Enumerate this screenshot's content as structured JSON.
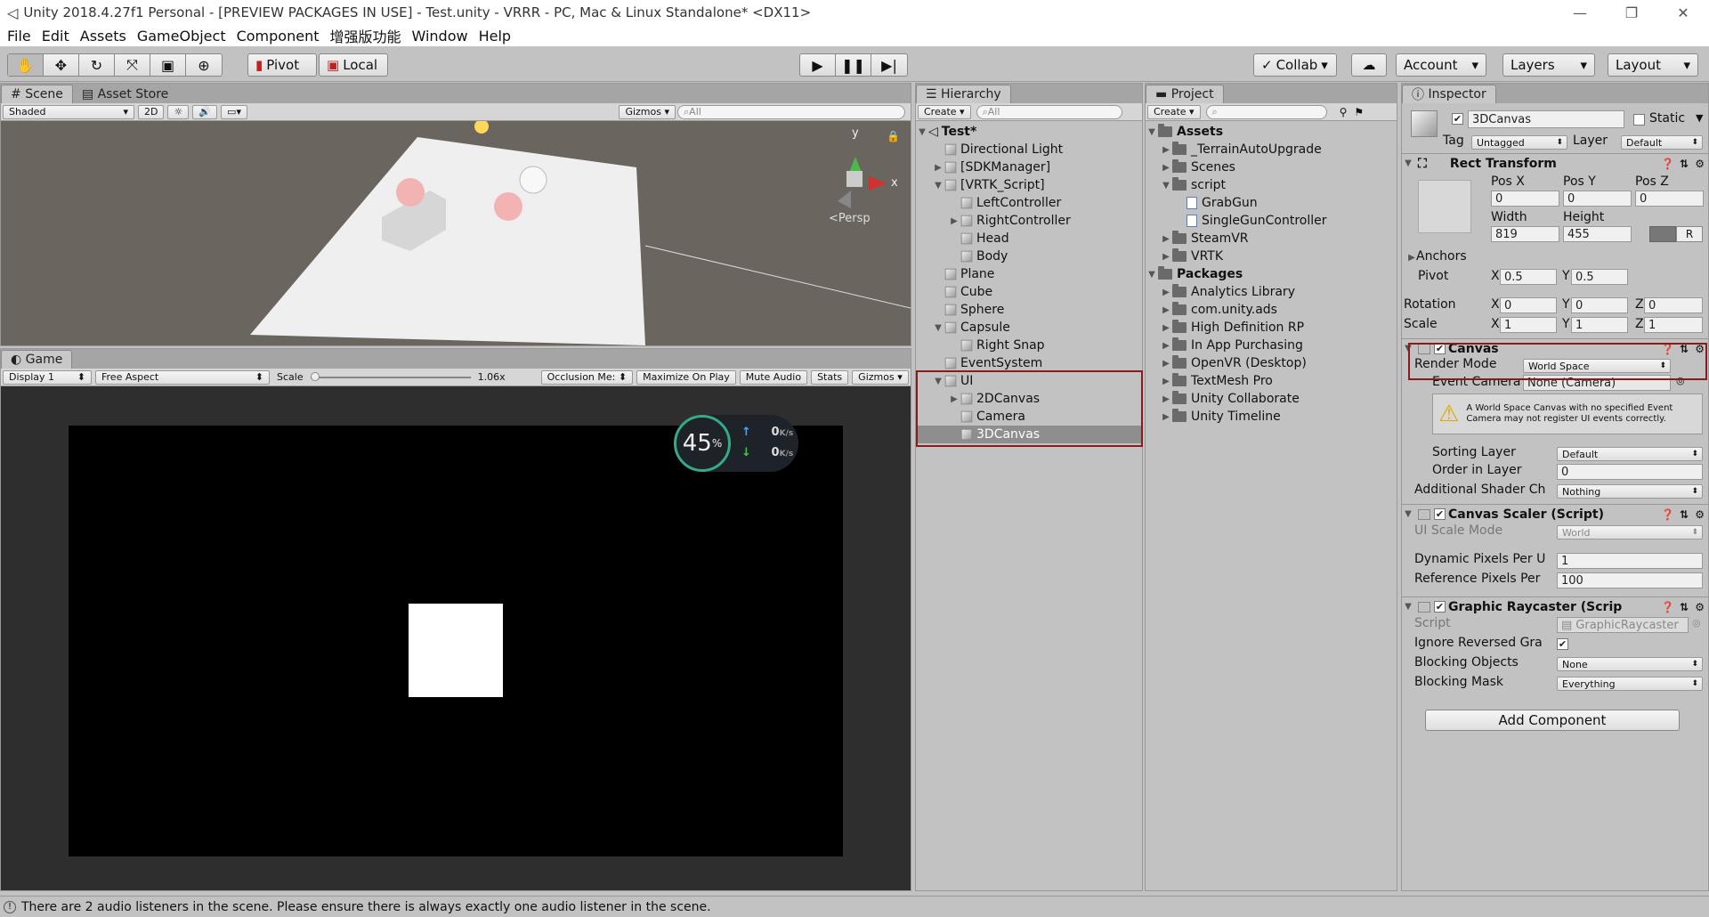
{
  "window": {
    "title": "Unity 2018.4.27f1 Personal - [PREVIEW PACKAGES IN USE] - Test.unity - VRRR - PC, Mac & Linux Standalone* <DX11>"
  },
  "menu": [
    "File",
    "Edit",
    "Assets",
    "GameObject",
    "Component",
    "增强版功能",
    "Window",
    "Help"
  ],
  "toolbar": {
    "pivot": "Pivot",
    "local": "Local",
    "collab": "Collab",
    "account": "Account",
    "layers": "Layers",
    "layout": "Layout"
  },
  "scene": {
    "tab": "Scene",
    "asset_store": "Asset Store",
    "shaded": "Shaded",
    "mode_2d": "2D",
    "gizmos": "Gizmos",
    "search_placeholder": "All",
    "persp": "Persp",
    "axis_y": "y",
    "axis_x": "x"
  },
  "game": {
    "tab": "Game",
    "display": "Display 1",
    "aspect": "Free Aspect",
    "scale_label": "Scale",
    "scale_value": "1.06x",
    "occlusion": "Occlusion Me:",
    "maximize": "Maximize On Play",
    "mute": "Mute Audio",
    "stats": "Stats",
    "gizmos": "Gizmos",
    "overlay_percent": "45",
    "overlay_percent_unit": "%",
    "overlay_up": "0",
    "overlay_down": "0",
    "overlay_unit": "K/s"
  },
  "hierarchy": {
    "tab": "Hierarchy",
    "create": "Create",
    "search_placeholder": "All",
    "scene_name": "Test*",
    "items": [
      {
        "label": "Directional Light",
        "indent": 1,
        "arrow": ""
      },
      {
        "label": "[SDKManager]",
        "indent": 1,
        "arrow": "▶"
      },
      {
        "label": "[VRTK_Script]",
        "indent": 1,
        "arrow": "▼"
      },
      {
        "label": "LeftController",
        "indent": 2,
        "arrow": ""
      },
      {
        "label": "RightController",
        "indent": 2,
        "arrow": "▶"
      },
      {
        "label": "Head",
        "indent": 2,
        "arrow": ""
      },
      {
        "label": "Body",
        "indent": 2,
        "arrow": ""
      },
      {
        "label": "Plane",
        "indent": 1,
        "arrow": ""
      },
      {
        "label": "Cube",
        "indent": 1,
        "arrow": ""
      },
      {
        "label": "Sphere",
        "indent": 1,
        "arrow": ""
      },
      {
        "label": "Capsule",
        "indent": 1,
        "arrow": "▼"
      },
      {
        "label": "Right Snap",
        "indent": 2,
        "arrow": ""
      },
      {
        "label": "EventSystem",
        "indent": 1,
        "arrow": ""
      },
      {
        "label": "UI",
        "indent": 1,
        "arrow": "▼"
      },
      {
        "label": "2DCanvas",
        "indent": 2,
        "arrow": "▶"
      },
      {
        "label": "Camera",
        "indent": 2,
        "arrow": ""
      },
      {
        "label": "3DCanvas",
        "indent": 2,
        "arrow": "",
        "selected": true
      }
    ]
  },
  "project": {
    "tab": "Project",
    "create": "Create",
    "items": [
      {
        "label": "Assets",
        "indent": 0,
        "arrow": "▼",
        "type": "folder",
        "bold": true
      },
      {
        "label": "_TerrainAutoUpgrade",
        "indent": 1,
        "arrow": "▶",
        "type": "folder"
      },
      {
        "label": "Scenes",
        "indent": 1,
        "arrow": "▶",
        "type": "folder"
      },
      {
        "label": "script",
        "indent": 1,
        "arrow": "▼",
        "type": "folder"
      },
      {
        "label": "GrabGun",
        "indent": 2,
        "arrow": "",
        "type": "script"
      },
      {
        "label": "SingleGunController",
        "indent": 2,
        "arrow": "",
        "type": "script"
      },
      {
        "label": "SteamVR",
        "indent": 1,
        "arrow": "▶",
        "type": "folder"
      },
      {
        "label": "VRTK",
        "indent": 1,
        "arrow": "▶",
        "type": "folder"
      },
      {
        "label": "Packages",
        "indent": 0,
        "arrow": "▼",
        "type": "folder",
        "bold": true
      },
      {
        "label": "Analytics Library",
        "indent": 1,
        "arrow": "▶",
        "type": "folder"
      },
      {
        "label": "com.unity.ads",
        "indent": 1,
        "arrow": "▶",
        "type": "folder"
      },
      {
        "label": "High Definition RP",
        "indent": 1,
        "arrow": "▶",
        "type": "folder"
      },
      {
        "label": "In App Purchasing",
        "indent": 1,
        "arrow": "▶",
        "type": "folder"
      },
      {
        "label": "OpenVR (Desktop)",
        "indent": 1,
        "arrow": "▶",
        "type": "folder"
      },
      {
        "label": "TextMesh Pro",
        "indent": 1,
        "arrow": "▶",
        "type": "folder"
      },
      {
        "label": "Unity Collaborate",
        "indent": 1,
        "arrow": "▶",
        "type": "folder"
      },
      {
        "label": "Unity Timeline",
        "indent": 1,
        "arrow": "▶",
        "type": "folder"
      }
    ]
  },
  "inspector": {
    "tab": "Inspector",
    "name": "3DCanvas",
    "static": "Static",
    "tag_label": "Tag",
    "tag": "Untagged",
    "layer_label": "Layer",
    "layer": "Default",
    "rect": {
      "title": "Rect Transform",
      "posx_label": "Pos X",
      "posy_label": "Pos Y",
      "posz_label": "Pos Z",
      "posx": "0",
      "posy": "0",
      "posz": "0",
      "width_label": "Width",
      "height_label": "Height",
      "width": "819",
      "height": "455",
      "r": "R",
      "anchors": "Anchors",
      "pivot_label": "Pivot",
      "pivot_x": "0.5",
      "pivot_y": "0.5",
      "rotation_label": "Rotation",
      "rot_x": "0",
      "rot_y": "0",
      "rot_z": "0",
      "scale_label": "Scale",
      "scale_x": "1",
      "scale_y": "1",
      "scale_z": "1",
      "x": "X",
      "y": "Y",
      "z": "Z"
    },
    "canvas": {
      "title": "Canvas",
      "render_mode_label": "Render Mode",
      "render_mode": "World Space",
      "event_camera_label": "Event Camera",
      "event_camera": "None (Camera)",
      "warning": "A World Space Canvas with no specified Event Camera may not register UI events correctly.",
      "sorting_layer_label": "Sorting Layer",
      "sorting_layer": "Default",
      "order_label": "Order in Layer",
      "order": "0",
      "shader_label": "Additional Shader Ch",
      "shader": "Nothing"
    },
    "scaler": {
      "title": "Canvas Scaler (Script)",
      "mode_label": "UI Scale Mode",
      "mode": "World",
      "dyn_label": "Dynamic Pixels Per U",
      "dyn": "1",
      "ref_label": "Reference Pixels Per",
      "ref": "100"
    },
    "raycaster": {
      "title": "Graphic Raycaster (Scrip",
      "script_label": "Script",
      "script": "GraphicRaycaster",
      "ignore_label": "Ignore Reversed Gra",
      "blocking_label": "Blocking Objects",
      "blocking": "None",
      "mask_label": "Blocking Mask",
      "mask": "Everything"
    },
    "add_component": "Add Component"
  },
  "status": "There are 2 audio listeners in the scene. Please ensure there is always exactly one audio listener in the scene."
}
